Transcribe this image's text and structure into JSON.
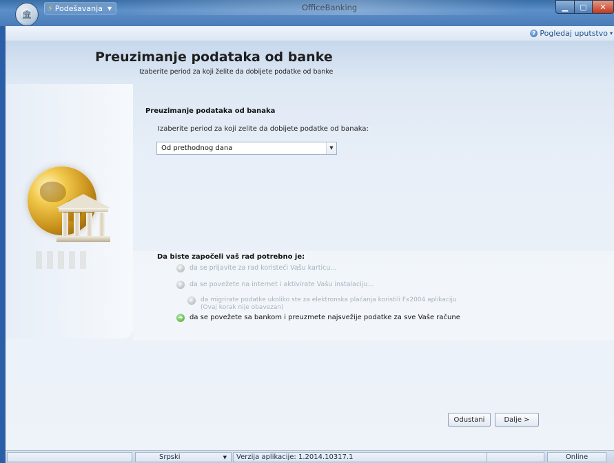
{
  "titlebar": {
    "app_icon": "bank-building-icon",
    "menu_label": "Podešavanja",
    "window_title": "OfficeBanking",
    "controls": {
      "minimize": "minimize-icon",
      "maximize": "maximize-icon",
      "close": "close-icon"
    }
  },
  "helpbar": {
    "help_label": "Pogledaj uputstvo"
  },
  "page": {
    "title": "Preuzimanje podataka od banke",
    "subtitle": "Izaberite period za koji želite da dobijete podatke od banke"
  },
  "form": {
    "section_title": "Preuzimanje podataka od banaka",
    "description": "Izaberite period za koji zelite da dobijete podatke od banaka:",
    "period_select": {
      "value": "Od prethodnog dana"
    }
  },
  "steps": {
    "title": "Da biste započeli vaš rad potrebno je:",
    "items": [
      {
        "text": "da se prijavite za rad koristeći Vašu karticu...",
        "sub": "",
        "state": "done"
      },
      {
        "text": "da se povežete na internet i aktivirate Vašu instalaciju...",
        "sub": "",
        "state": "done"
      },
      {
        "text": "da migrirate podatke ukoliko ste za elektronska plaćanja koristili Fx2004 aplikaciju",
        "sub": "(Ovaj korak nije obavezan)",
        "state": "done"
      },
      {
        "text": "da se povežete sa bankom i preuzmete najsvežije podatke za sve Vaše račune",
        "sub": "",
        "state": "active"
      }
    ]
  },
  "buttons": {
    "cancel": "Odustani",
    "next": "Dalje >"
  },
  "statusbar": {
    "language": "Srpski",
    "version": "Verzija aplikacije: 1.2014.10317.1",
    "connection": "Online"
  },
  "colors": {
    "accent": "#3a6fa8",
    "active_step": "#3fa62c",
    "disabled_text": "#a7b2bd"
  }
}
